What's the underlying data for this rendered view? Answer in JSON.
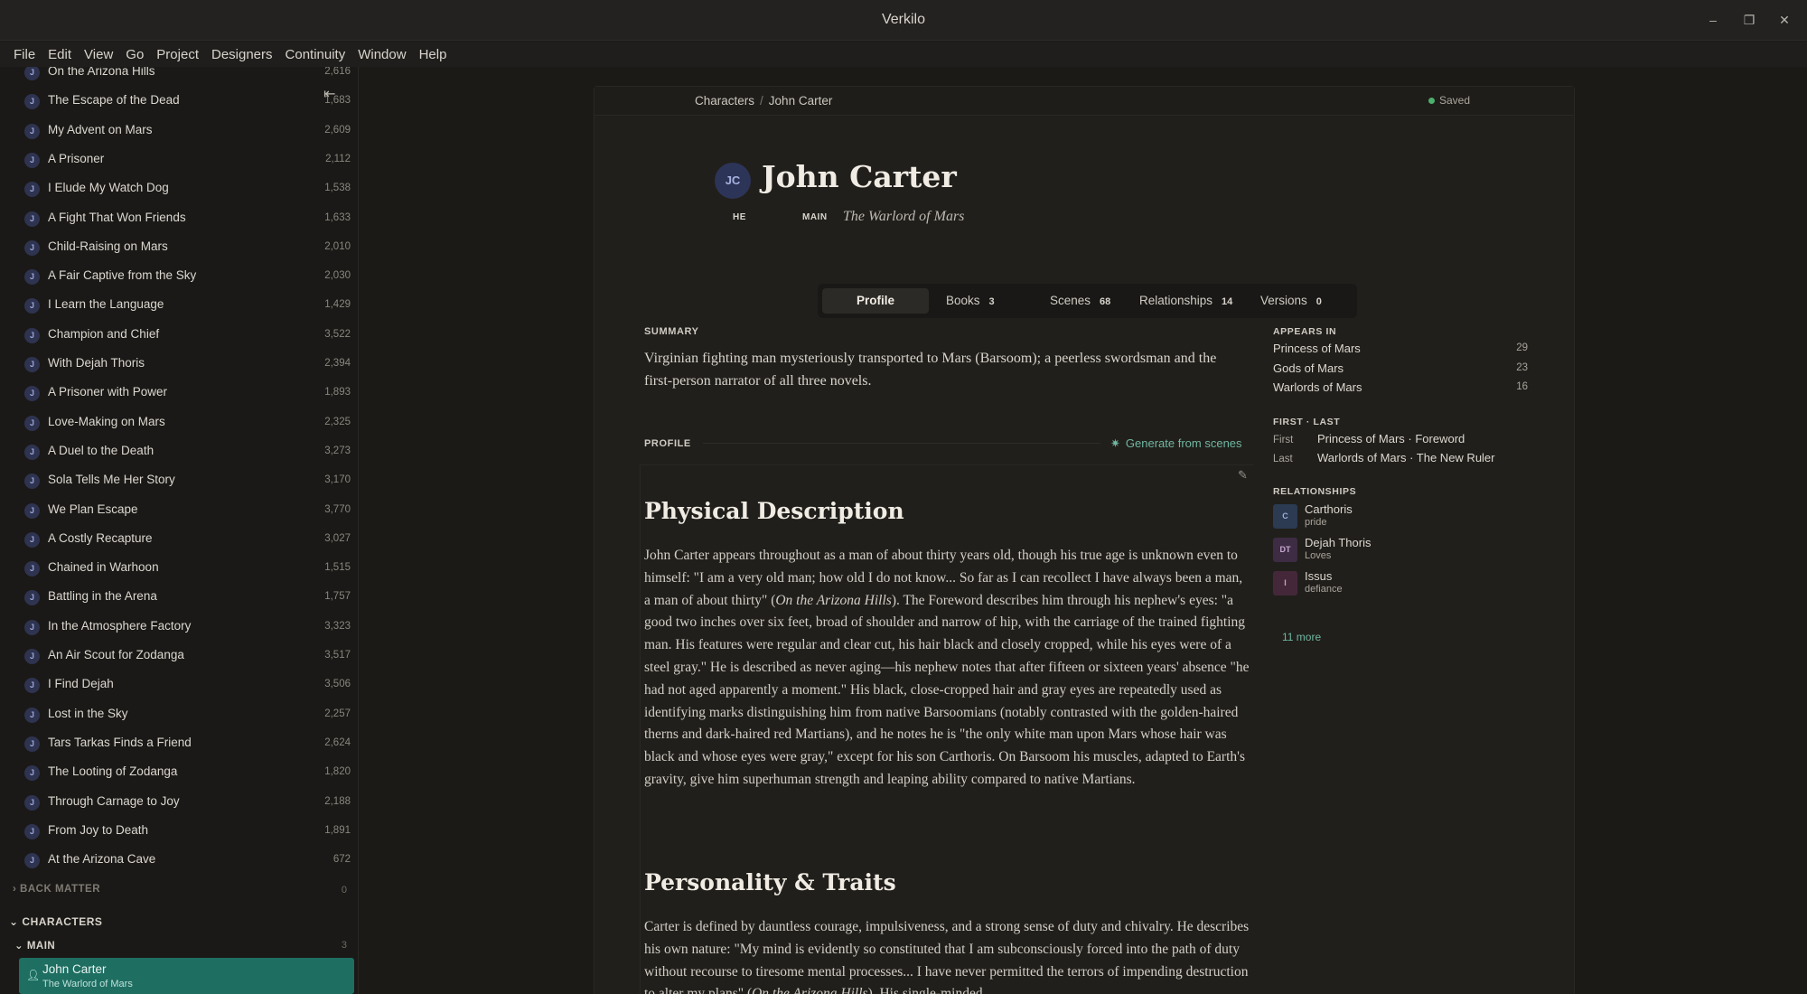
{
  "window": {
    "title": "Verkilo"
  },
  "menu": [
    "File",
    "Edit",
    "View",
    "Go",
    "Project",
    "Designers",
    "Continuity",
    "Window",
    "Help"
  ],
  "sidebar": {
    "chapters": [
      {
        "badge": "J",
        "title": "On the Arizona Hills",
        "count": "2,616"
      },
      {
        "badge": "J",
        "title": "The Escape of the Dead",
        "count": "1,683"
      },
      {
        "badge": "J",
        "title": "My Advent on Mars",
        "count": "2,609"
      },
      {
        "badge": "J",
        "title": "A Prisoner",
        "count": "2,112"
      },
      {
        "badge": "J",
        "title": "I Elude My Watch Dog",
        "count": "1,538"
      },
      {
        "badge": "J",
        "title": "A Fight That Won Friends",
        "count": "1,633"
      },
      {
        "badge": "J",
        "title": "Child-Raising on Mars",
        "count": "2,010"
      },
      {
        "badge": "J",
        "title": "A Fair Captive from the Sky",
        "count": "2,030"
      },
      {
        "badge": "J",
        "title": "I Learn the Language",
        "count": "1,429"
      },
      {
        "badge": "J",
        "title": "Champion and Chief",
        "count": "3,522"
      },
      {
        "badge": "J",
        "title": "With Dejah Thoris",
        "count": "2,394"
      },
      {
        "badge": "J",
        "title": "A Prisoner with Power",
        "count": "1,893"
      },
      {
        "badge": "J",
        "title": "Love-Making on Mars",
        "count": "2,325"
      },
      {
        "badge": "J",
        "title": "A Duel to the Death",
        "count": "3,273"
      },
      {
        "badge": "J",
        "title": "Sola Tells Me Her Story",
        "count": "3,170"
      },
      {
        "badge": "J",
        "title": "We Plan Escape",
        "count": "3,770"
      },
      {
        "badge": "J",
        "title": "A Costly Recapture",
        "count": "3,027"
      },
      {
        "badge": "J",
        "title": "Chained in Warhoon",
        "count": "1,515"
      },
      {
        "badge": "J",
        "title": "Battling in the Arena",
        "count": "1,757"
      },
      {
        "badge": "J",
        "title": "In the Atmosphere Factory",
        "count": "3,323"
      },
      {
        "badge": "J",
        "title": "An Air Scout for Zodanga",
        "count": "3,517"
      },
      {
        "badge": "J",
        "title": "I Find Dejah",
        "count": "3,506"
      },
      {
        "badge": "J",
        "title": "Lost in the Sky",
        "count": "2,257"
      },
      {
        "badge": "J",
        "title": "Tars Tarkas Finds a Friend",
        "count": "2,624"
      },
      {
        "badge": "J",
        "title": "The Looting of Zodanga",
        "count": "1,820"
      },
      {
        "badge": "J",
        "title": "Through Carnage to Joy",
        "count": "2,188"
      },
      {
        "badge": "J",
        "title": "From Joy to Death",
        "count": "1,891"
      },
      {
        "badge": "J",
        "title": "At the Arizona Cave",
        "count": "672"
      }
    ],
    "back_matter": {
      "label": "BACK MATTER",
      "count": "0"
    },
    "characters": {
      "label": "CHARACTERS"
    },
    "main_group": {
      "label": "MAIN",
      "count": "3"
    },
    "selected": {
      "name": "John Carter",
      "subtitle": "The Warlord of Mars"
    }
  },
  "breadcrumb": {
    "parent": "Characters",
    "sep": "/",
    "current": "John Carter"
  },
  "status": {
    "saved": "Saved",
    "color": "#4caf6e"
  },
  "character": {
    "initials": "JC",
    "name": "John Carter",
    "pronoun_tag": "HE",
    "role_tag": "MAIN",
    "epithet": "The Warlord of Mars"
  },
  "tabs": [
    {
      "label": "Profile",
      "count": ""
    },
    {
      "label": "Books",
      "count": "3"
    },
    {
      "label": "Scenes",
      "count": "68"
    },
    {
      "label": "Relationships",
      "count": "14"
    },
    {
      "label": "Versions",
      "count": "0"
    }
  ],
  "summary": {
    "label": "SUMMARY",
    "text": "Virginian fighting man mysteriously transported to Mars (Barsoom); a peerless swordsman and the first-person narrator of all three novels."
  },
  "profile": {
    "label": "PROFILE",
    "generate_label": "Generate from scenes",
    "sections": [
      {
        "heading": "Physical Description",
        "p_before": "John Carter appears throughout as a man of about thirty years old, though his true age is unknown even to himself: \"I am a very old man; how old I do not know... So far as I can recollect I have always been a man, a man of about thirty\" (",
        "p_italic": "On the Arizona Hills",
        "p_after": "). The Foreword describes him through his nephew's eyes: \"a good two inches over six feet, broad of shoulder and narrow of hip, with the carriage of the trained fighting man. His features were regular and clear cut, his hair black and closely cropped, while his eyes were of a steel gray.\" He is described as never aging—his nephew notes that after fifteen or sixteen years' absence \"he had not aged apparently a moment.\" His black, close-cropped hair and gray eyes are repeatedly used as identifying marks distinguishing him from native Barsoomians (notably contrasted with the golden-haired therns and dark-haired red Martians), and he notes he is \"the only white man upon Mars whose hair was black and whose eyes were gray,\" except for his son Carthoris. On Barsoom his muscles, adapted to Earth's gravity, give him superhuman strength and leaping ability compared to native Martians."
      },
      {
        "heading": "Personality & Traits",
        "p_before": "Carter is defined by dauntless courage, impulsiveness, and a strong sense of duty and chivalry. He describes his own nature: \"My mind is evidently so constituted that I am subconsciously forced into the path of duty without recourse to tiresome mental processes... I have never permitted the terrors of impending destruction to alter my plans\" (",
        "p_italic": "On the Arizona Hills",
        "p_after": "). His single-minded ..."
      }
    ]
  },
  "appears_in": {
    "label": "APPEARS IN",
    "items": [
      {
        "title": "Princess of Mars",
        "count": "29"
      },
      {
        "title": "Gods of Mars",
        "count": "23"
      },
      {
        "title": "Warlords of Mars",
        "count": "16"
      }
    ]
  },
  "first_last": {
    "label": "FIRST · LAST",
    "first_key": "First",
    "first_value": "Princess of Mars · Foreword",
    "last_key": "Last",
    "last_value": "Warlords of Mars · The New Ruler"
  },
  "relationships": {
    "label": "RELATIONSHIPS",
    "items": [
      {
        "initials": "C",
        "name": "Carthoris",
        "desc": "pride",
        "bg": "#2c3a52",
        "fg": "#9cb2d8"
      },
      {
        "initials": "DT",
        "name": "Dejah Thoris",
        "desc": "Loves",
        "bg": "#3d2c44",
        "fg": "#c8a8d0"
      },
      {
        "initials": "I",
        "name": "Issus",
        "desc": "defiance",
        "bg": "#44283a",
        "fg": "#d0a0b8"
      }
    ],
    "more": "11 more"
  },
  "colors": {
    "accent": "#1e6e62",
    "link": "#6fb6a2"
  }
}
